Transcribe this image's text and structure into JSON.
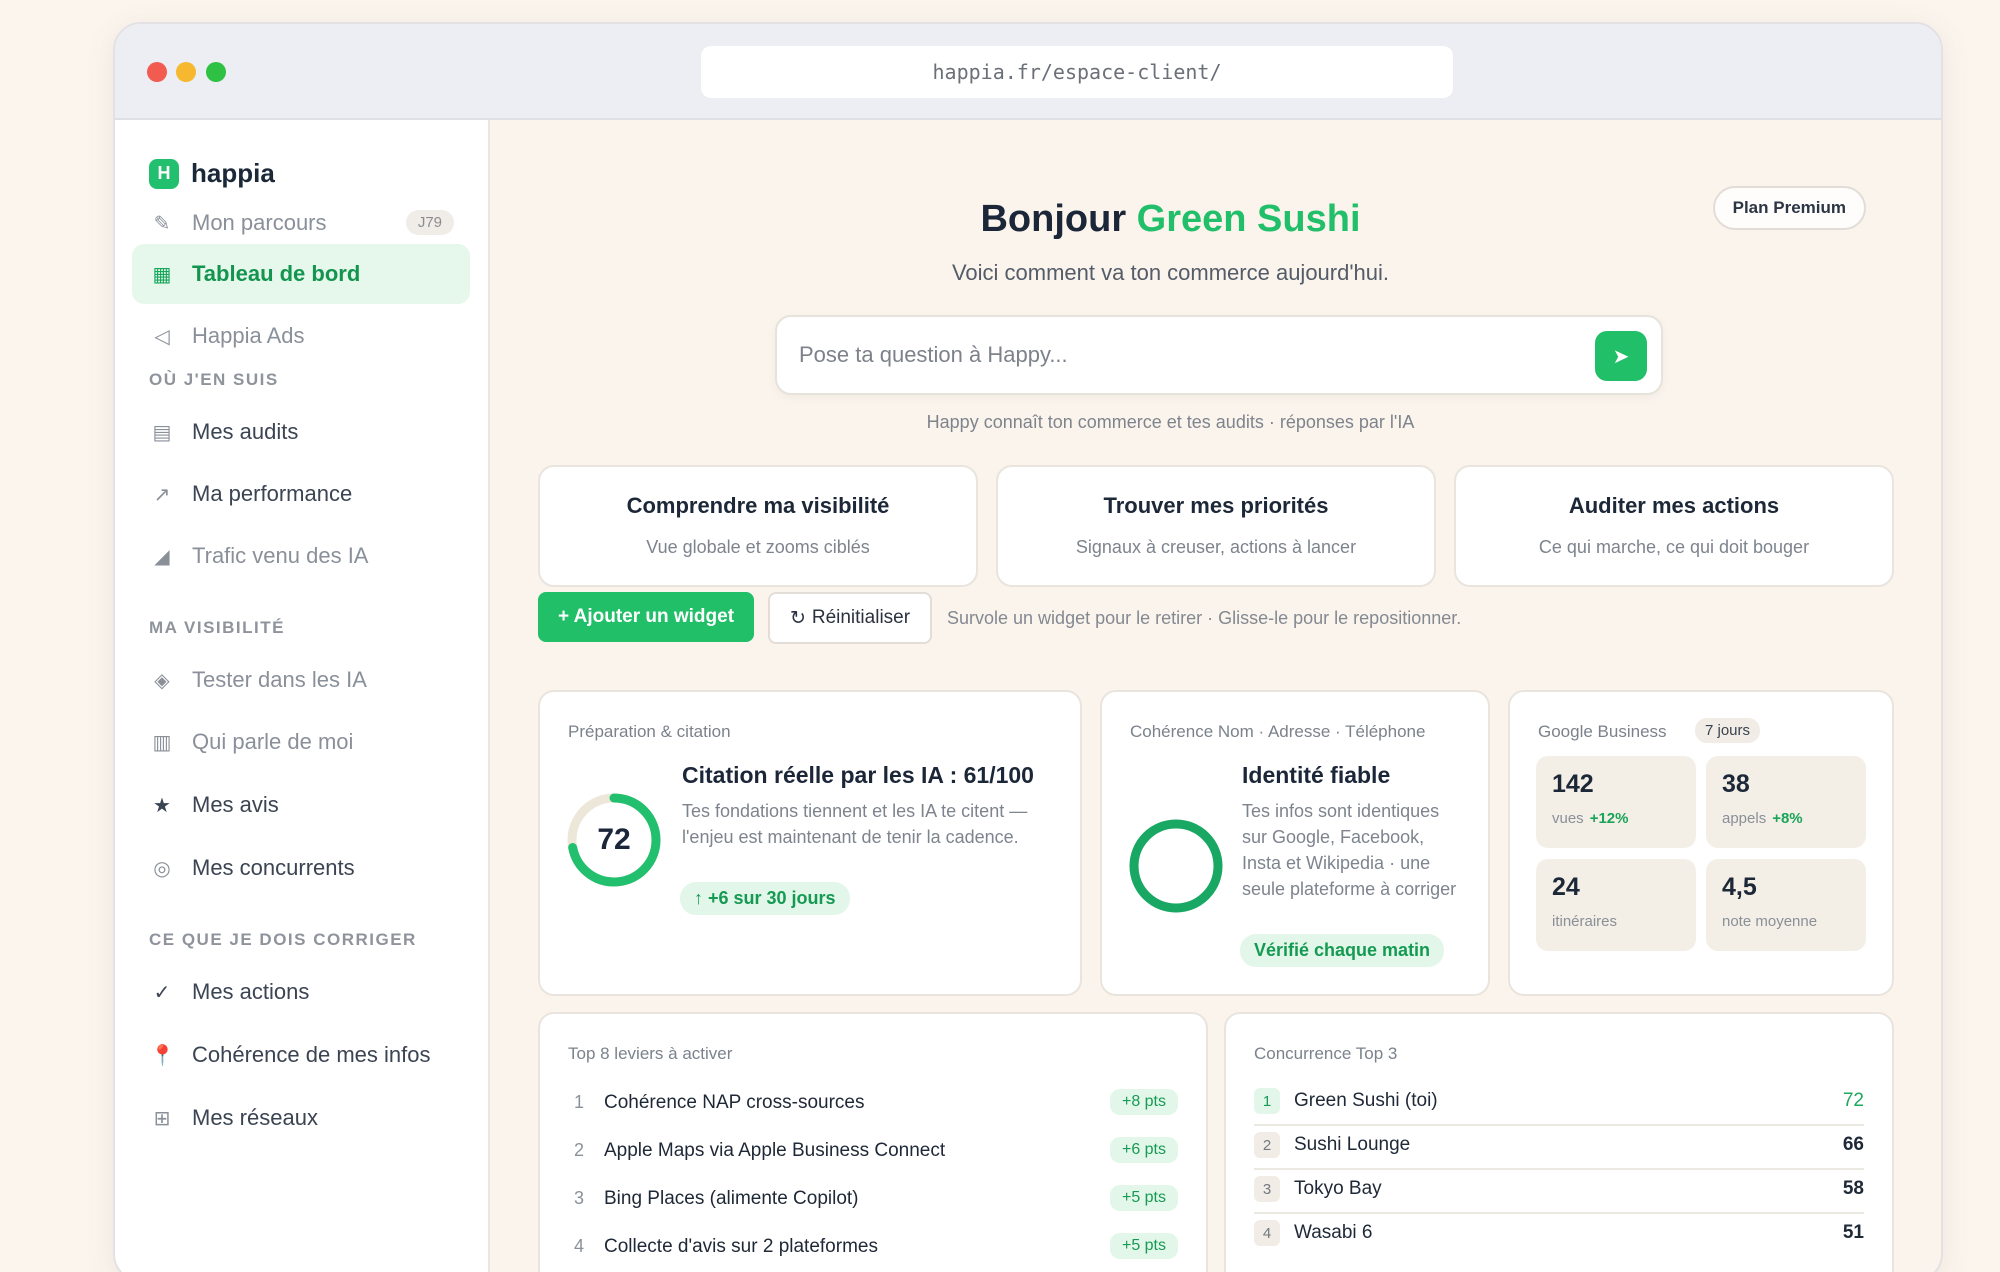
{
  "browser": {
    "url": "happia.fr/espace-client/"
  },
  "app": {
    "name": "happia",
    "logo_letter": "H"
  },
  "sidebar": {
    "parcours": {
      "label": "Mon parcours",
      "badge": "J79"
    },
    "dashboard": {
      "label": "Tableau de bord"
    },
    "ads": {
      "label": "Happia Ads"
    },
    "section_where": "OÙ J'EN SUIS",
    "audits": {
      "label": "Mes audits"
    },
    "performance": {
      "label": "Ma performance"
    },
    "trafic": {
      "label": "Trafic venu des IA"
    },
    "section_visibility": "MA VISIBILITÉ",
    "tester": {
      "label": "Tester dans les IA"
    },
    "parle": {
      "label": "Qui parle de moi"
    },
    "avis": {
      "label": "Mes avis"
    },
    "concurrents": {
      "label": "Mes concurrents"
    },
    "section_fix": "CE QUE JE DOIS CORRIGER",
    "actions": {
      "label": "Mes actions"
    },
    "coherence": {
      "label": "Cohérence de mes infos"
    },
    "reseaux": {
      "label": "Mes réseaux"
    }
  },
  "header": {
    "greeting_prefix": "Bonjour",
    "business_name": "Green Sushi",
    "plan": "Plan Premium",
    "subtitle": "Voici comment va ton commerce aujourd'hui."
  },
  "ask": {
    "placeholder": "Pose ta question à Happy...",
    "hint": "Happy connaît ton commerce et tes audits · réponses par l'IA"
  },
  "modes": [
    {
      "title": "Comprendre ma visibilité",
      "subtitle": "Vue globale et zooms ciblés"
    },
    {
      "title": "Trouver mes priorités",
      "subtitle": "Signaux à creuser, actions à lancer"
    },
    {
      "title": "Auditer mes actions",
      "subtitle": "Ce qui marche, ce qui doit bouger"
    }
  ],
  "toolbar": {
    "add_label": "+ Ajouter un widget",
    "reset_label": "Réinitialiser",
    "hint": "Survole un widget pour le retirer · Glisse-le pour le repositionner."
  },
  "widget_citation": {
    "title": "Préparation & citation",
    "score": "72",
    "score_fraction": 0.72,
    "headline": "Citation réelle par les IA : 61/100",
    "description": "Tes fondations tiennent et les IA te citent — l'enjeu est maintenant de tenir la cadence.",
    "trend": "↑ +6 sur 30 jours"
  },
  "widget_nap": {
    "title": "Cohérence Nom · Adresse · Téléphone",
    "headline": "Identité fiable",
    "description": "Tes infos sont identiques sur Google, Facebook, Insta et Wikipedia · une seule plateforme à corriger",
    "chip": "Vérifié chaque matin",
    "ring_fraction": 1.0
  },
  "widget_google": {
    "title": "Google Business",
    "period": "7 jours",
    "stats": [
      {
        "value": "142",
        "label": "vues",
        "delta": "+12%"
      },
      {
        "value": "38",
        "label": "appels",
        "delta": "+8%"
      },
      {
        "value": "24",
        "label": "itinéraires",
        "delta": ""
      },
      {
        "value": "4,5",
        "label": "note moyenne",
        "delta": ""
      }
    ]
  },
  "widget_levers": {
    "title": "Top 8 leviers à activer",
    "items": [
      {
        "rank": "1",
        "label": "Cohérence NAP cross-sources",
        "points": "+8 pts"
      },
      {
        "rank": "2",
        "label": "Apple Maps via Apple Business Connect",
        "points": "+6 pts"
      },
      {
        "rank": "3",
        "label": "Bing Places (alimente Copilot)",
        "points": "+5 pts"
      },
      {
        "rank": "4",
        "label": "Collecte d'avis sur 2 plateformes",
        "points": "+5 pts"
      }
    ]
  },
  "widget_competition": {
    "title": "Concurrence Top 3",
    "items": [
      {
        "rank": "1",
        "name": "Green Sushi (toi)",
        "score": "72"
      },
      {
        "rank": "2",
        "name": "Sushi Lounge",
        "score": "66"
      },
      {
        "rank": "3",
        "name": "Tokyo Bay",
        "score": "58"
      },
      {
        "rank": "4",
        "name": "Wasabi 6",
        "score": "51"
      }
    ]
  },
  "colors": {
    "accent": "#20bf68",
    "accent_dark": "#14954f",
    "ring_track": "#ece7d8"
  }
}
